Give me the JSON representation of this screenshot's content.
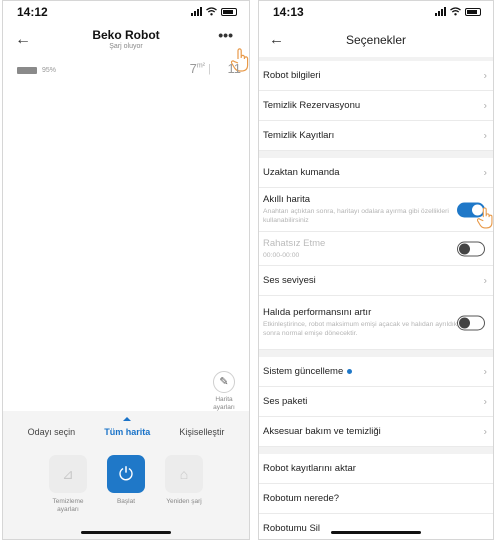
{
  "left": {
    "status": {
      "time": "14:12"
    },
    "header": {
      "title": "Beko Robot",
      "subtitle": "Şarj oluyor",
      "more": "•••"
    },
    "stats": {
      "battery": "95%",
      "area": "7",
      "area_unit": "m²",
      "time": "11"
    },
    "map_settings": {
      "label": "Harita ayarları"
    },
    "tabs": [
      {
        "label": "Odayı seçin"
      },
      {
        "label": "Tüm harita"
      },
      {
        "label": "Kişiselleştir"
      }
    ],
    "actions": [
      {
        "label": "Temizleme ayarları"
      },
      {
        "label": "Başlat"
      },
      {
        "label": "Yeniden şarj"
      }
    ]
  },
  "right": {
    "status": {
      "time": "14:13"
    },
    "header": {
      "title": "Seçenekler"
    },
    "rows": {
      "robot_info": "Robot bilgileri",
      "reservation": "Temizlik Rezervasyonu",
      "records": "Temizlik Kayıtları",
      "remote": "Uzaktan kumanda",
      "smart_map": "Akıllı harita",
      "smart_map_desc": "Anahtarı açtıktan sonra, haritayı odalara ayırma gibi özellikleri kullanabilirsiniz",
      "dnd": "Rahatsız Etme",
      "dnd_time": "00:00-00:00",
      "volume": "Ses seviyesi",
      "carpet": "Halıda performansını artır",
      "carpet_desc": "Etkinleştirince, robot maksimum emişi açacak ve halıdan ayrıldıktan sonra normal emişe dönecektir.",
      "system_update": "Sistem güncelleme",
      "voice_pack": "Ses paketi",
      "accessory": "Aksesuar bakım ve temizliği",
      "transfer": "Robot kayıtlarını aktar",
      "find": "Robotum nerede?",
      "delete": "Robotumu Sil"
    },
    "toggles": {
      "smart_map": true,
      "dnd": false,
      "carpet": false
    }
  },
  "colors": {
    "accent": "#1f78c8"
  }
}
